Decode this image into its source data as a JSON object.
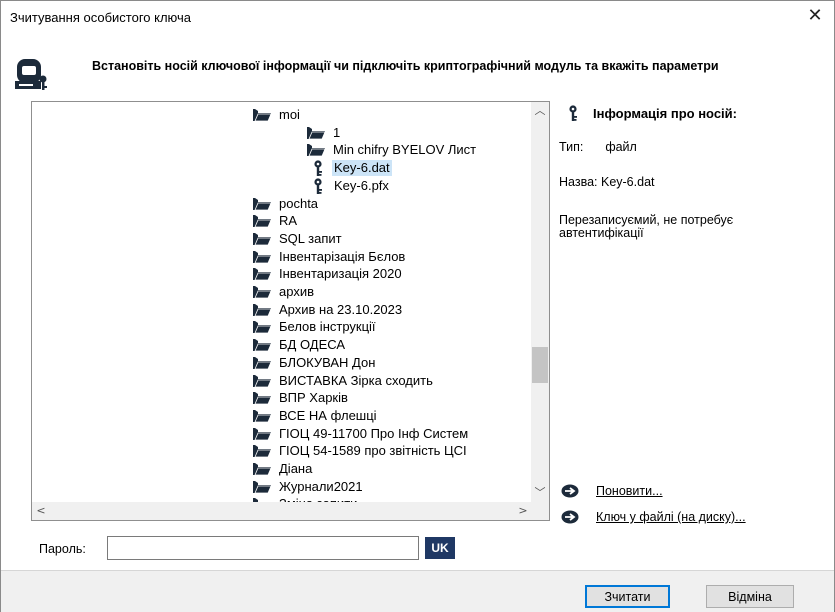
{
  "window": {
    "title": "Зчитування особистого ключа",
    "close_glyph": "✕"
  },
  "header": {
    "icon": "key-media-icon",
    "text": "Встановіть носій ключової інформації чи підключіть криптографічний модуль та вкажіть параметри"
  },
  "tree": {
    "items": [
      {
        "label": "moi",
        "icon": "open-folder-icon",
        "level": 1
      },
      {
        "label": "1",
        "icon": "open-folder-icon",
        "level": 2
      },
      {
        "label": "Min chifry BYELOV  Лист",
        "icon": "open-folder-icon",
        "level": 2
      },
      {
        "label": "Key-6.dat",
        "icon": "key-icon",
        "level": 2,
        "selected": true
      },
      {
        "label": "Key-6.pfx",
        "icon": "key-icon",
        "level": 2
      },
      {
        "label": "pochta",
        "icon": "open-folder-icon",
        "level": 0
      },
      {
        "label": "RA",
        "icon": "open-folder-icon",
        "level": 0
      },
      {
        "label": "SQL запит",
        "icon": "open-folder-icon",
        "level": 0
      },
      {
        "label": "Інвентарізація Бєлов",
        "icon": "open-folder-icon",
        "level": 0
      },
      {
        "label": "Інвентаризація 2020",
        "icon": "open-folder-icon",
        "level": 0
      },
      {
        "label": "архив",
        "icon": "open-folder-icon",
        "level": 0
      },
      {
        "label": "Архив на 23.10.2023",
        "icon": "open-folder-icon",
        "level": 0
      },
      {
        "label": "Белов інструкції",
        "icon": "open-folder-icon",
        "level": 0
      },
      {
        "label": "БД ОДЕСА",
        "icon": "open-folder-icon",
        "level": 0
      },
      {
        "label": "БЛОКУВАН Дон",
        "icon": "open-folder-icon",
        "level": 0
      },
      {
        "label": "ВИСТАВКА Зірка сходить",
        "icon": "open-folder-icon",
        "level": 0
      },
      {
        "label": "ВПР Харків",
        "icon": "open-folder-icon",
        "level": 0
      },
      {
        "label": "ВСЕ НА флешці",
        "icon": "open-folder-icon",
        "level": 0
      },
      {
        "label": "ГІОЦ 49-11700 Про Інф Систем",
        "icon": "open-folder-icon",
        "level": 0
      },
      {
        "label": "ГІОЦ 54-1589 про звітність ЦСІ",
        "icon": "open-folder-icon",
        "level": 0
      },
      {
        "label": "Діана",
        "icon": "open-folder-icon",
        "level": 0
      },
      {
        "label": "Журнали2021",
        "icon": "open-folder-icon",
        "level": 0
      },
      {
        "label": "Зміна  запити",
        "icon": "open-folder-icon",
        "level": 0
      }
    ]
  },
  "info": {
    "title": "Інформація про носій:",
    "type_label": "Тип:",
    "type_value": "файл",
    "name_label": "Назва:",
    "name_value": "Key-6.dat",
    "description": "Перезаписуємий, не потребує автентифікації"
  },
  "links": {
    "refresh": "Поновити...",
    "key_file": "Ключ у файлі (на диску)..."
  },
  "password": {
    "label": "Пароль:",
    "value": "",
    "language": "UK"
  },
  "buttons": {
    "ok": "Зчитати",
    "cancel": "Відміна"
  },
  "colors": {
    "selection": "#cce4f7",
    "language_badge": "#1f3864",
    "default_button_border": "#0078d7"
  }
}
